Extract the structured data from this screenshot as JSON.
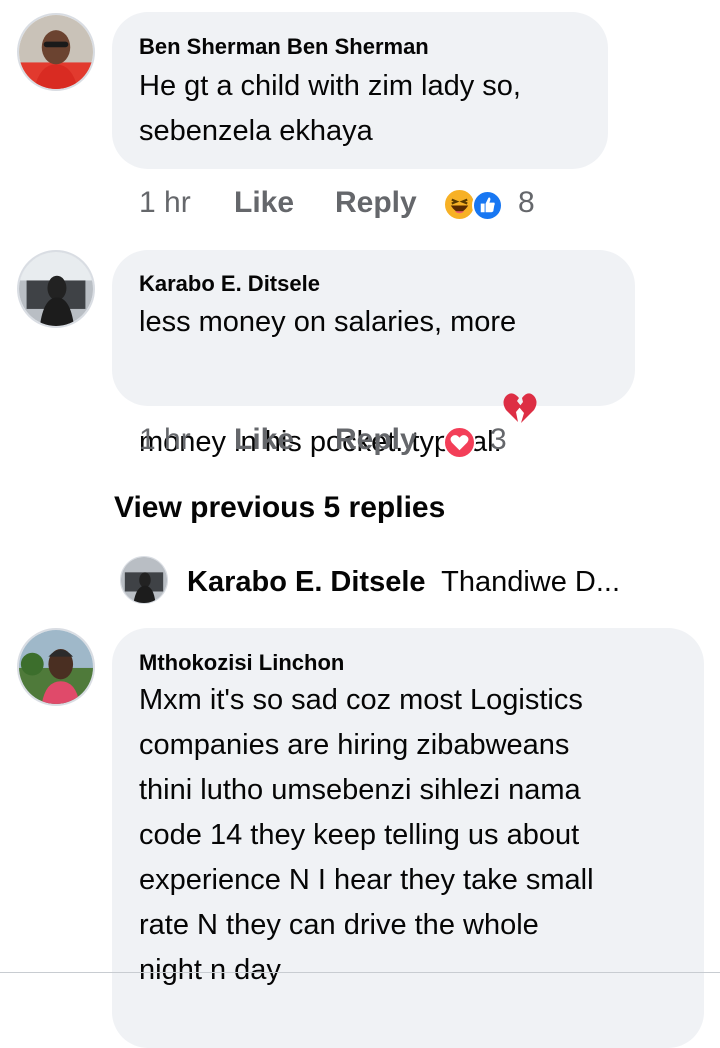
{
  "comments": [
    {
      "author": "Ben Sherman Ben Sherman",
      "text": "He gt a child with zim lady so,\nsebenzela ekhaya",
      "time": "1 hr",
      "like_label": "Like",
      "reply_label": "Reply",
      "reaction_icons": [
        "haha-icon",
        "like-icon"
      ],
      "reaction_count": "8"
    },
    {
      "author": "Karabo E. Ditsele",
      "text": "less money on salaries, more\nmoney in his pocket. typical.",
      "emoji": "broken-heart-icon",
      "time": "1 hr",
      "like_label": "Like",
      "reply_label": "Reply",
      "reaction_icons": [
        "love-icon"
      ],
      "reaction_count": "3"
    }
  ],
  "view_previous": "View previous 5 replies",
  "reply_preview": {
    "author": "Karabo E. Ditsele",
    "text": "Thandiwe D..."
  },
  "comment3": {
    "author": "Mthokozisi Linchon",
    "text": "Mxm it's so sad coz most Logistics\ncompanies are hiring zibabweans\nthini lutho umsebenzi sihlezi nama\ncode 14 they keep telling us about\nexperience N I hear they take small\nrate N they can drive the whole\nnight n day"
  },
  "colors": {
    "bubble": "#f0f2f5",
    "meta_text": "#65676b",
    "love": "#f33e58",
    "like": "#1877f2",
    "haha": "#f7b125"
  }
}
